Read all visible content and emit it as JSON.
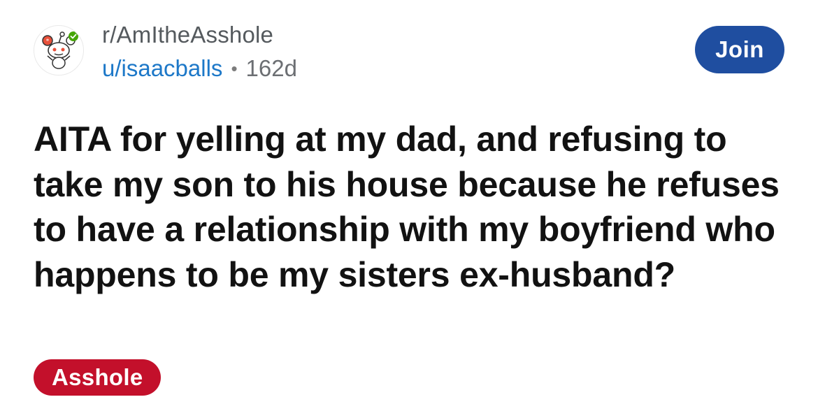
{
  "post": {
    "subreddit": "r/AmItheAsshole",
    "username": "u/isaacballs",
    "separator": "•",
    "age": "162d",
    "join_label": "Join",
    "title": "AITA for yelling at my dad, and refusing to take my son to his house because he refuses to have a relationship with my boyfriend who happens to be my sisters ex-husband?",
    "flair": "Asshole"
  },
  "colors": {
    "join_button": "#1f4ea0",
    "flair_background": "#c3102b",
    "username_link": "#1d78c8",
    "avatar_accent_red": "#e8503a",
    "avatar_check_green": "#46a508"
  },
  "icons": {
    "avatar": "subreddit-snoo-icon"
  }
}
